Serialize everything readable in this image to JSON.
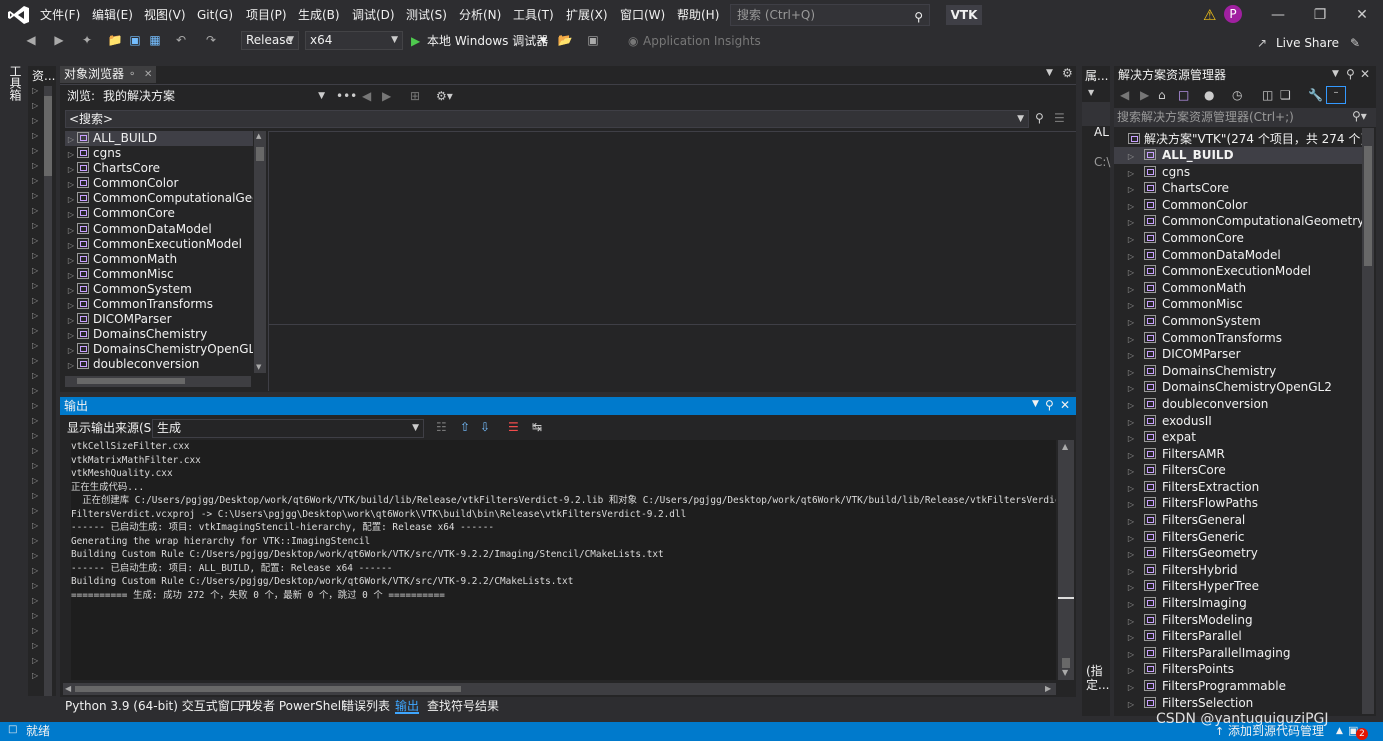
{
  "menu": [
    "文件(F)",
    "编辑(E)",
    "视图(V)",
    "Git(G)",
    "项目(P)",
    "生成(B)",
    "调试(D)",
    "测试(S)",
    "分析(N)",
    "工具(T)",
    "扩展(X)",
    "窗口(W)",
    "帮助(H)"
  ],
  "search": {
    "placeholder": "搜索 (Ctrl+Q)"
  },
  "solution_name": "VTK",
  "user_initial": "P",
  "toolbar": {
    "config": "Release",
    "platform": "x64",
    "run_label": "本地 Windows 调试器",
    "app_insights": "Application Insights",
    "live_share": "Live Share"
  },
  "left_toolbox": "工具箱",
  "left_strip": "资...",
  "object_browser": {
    "tab": "对象浏览器",
    "browse_label": "浏览:",
    "browse_value": "我的解决方案",
    "search_placeholder": "<搜索>",
    "items": [
      "ALL_BUILD",
      "cgns",
      "ChartsCore",
      "CommonColor",
      "CommonComputationalGeome",
      "CommonCore",
      "CommonDataModel",
      "CommonExecutionModel",
      "CommonMath",
      "CommonMisc",
      "CommonSystem",
      "CommonTransforms",
      "DICOMParser",
      "DomainsChemistry",
      "DomainsChemistryOpenGL2",
      "doubleconversion"
    ]
  },
  "properties_strip": {
    "tab": "属...",
    "t1": "AL",
    "t2": "C:\\",
    "bottom": "(指定..."
  },
  "output": {
    "title": "输出",
    "source_label": "显示输出来源(S):",
    "source_value": "生成",
    "lines": [
      "vtkCellSizeFilter.cxx",
      "vtkMatrixMathFilter.cxx",
      "vtkMeshQuality.cxx",
      "正在生成代码...",
      "  正在创建库 C:/Users/pgjgg/Desktop/work/qt6Work/VTK/build/lib/Release/vtkFiltersVerdict-9.2.lib 和对象 C:/Users/pgjgg/Desktop/work/qt6Work/VTK/build/lib/Release/vtkFiltersVerdict-9.2",
      "FiltersVerdict.vcxproj -> C:\\Users\\pgjgg\\Desktop\\work\\qt6Work\\VTK\\build\\bin\\Release\\vtkFiltersVerdict-9.2.dll",
      "------ 已启动生成: 项目: vtkImagingStencil-hierarchy, 配置: Release x64 ------",
      "Generating the wrap hierarchy for VTK::ImagingStencil",
      "Building Custom Rule C:/Users/pgjgg/Desktop/work/qt6Work/VTK/src/VTK-9.2.2/Imaging/Stencil/CMakeLists.txt",
      "------ 已启动生成: 项目: ALL_BUILD, 配置: Release x64 ------",
      "Building Custom Rule C:/Users/pgjgg/Desktop/work/qt6Work/VTK/src/VTK-9.2.2/CMakeLists.txt",
      "========== 生成: 成功 272 个，失败 0 个，最新 0 个，跳过 0 个 =========="
    ]
  },
  "bottom_tabs": [
    "Python 3.9 (64-bit) 交互式窗口 1",
    "开发者 PowerShell",
    "错误列表",
    "输出",
    "查找符号结果"
  ],
  "solution_explorer": {
    "title": "解决方案资源管理器",
    "search_placeholder": "搜索解决方案资源管理器(Ctrl+;)",
    "root": "解决方案\"VTK\"(274 个项目，共 274 个)",
    "items": [
      "ALL_BUILD",
      "cgns",
      "ChartsCore",
      "CommonColor",
      "CommonComputationalGeometry",
      "CommonCore",
      "CommonDataModel",
      "CommonExecutionModel",
      "CommonMath",
      "CommonMisc",
      "CommonSystem",
      "CommonTransforms",
      "DICOMParser",
      "DomainsChemistry",
      "DomainsChemistryOpenGL2",
      "doubleconversion",
      "exodusII",
      "expat",
      "FiltersAMR",
      "FiltersCore",
      "FiltersExtraction",
      "FiltersFlowPaths",
      "FiltersGeneral",
      "FiltersGeneric",
      "FiltersGeometry",
      "FiltersHybrid",
      "FiltersHyperTree",
      "FiltersImaging",
      "FiltersModeling",
      "FiltersParallel",
      "FiltersParallelImaging",
      "FiltersPoints",
      "FiltersProgrammable",
      "FiltersSelection"
    ]
  },
  "status": {
    "left": "就绪",
    "source_control": "添加到源代码管理",
    "notifications": "2",
    "watermark": "CSDN @yantuguiguziPGJ"
  },
  "colors": {
    "accent": "#007acc",
    "bg": "#1e1e1e",
    "chrome": "#2d2d30"
  }
}
